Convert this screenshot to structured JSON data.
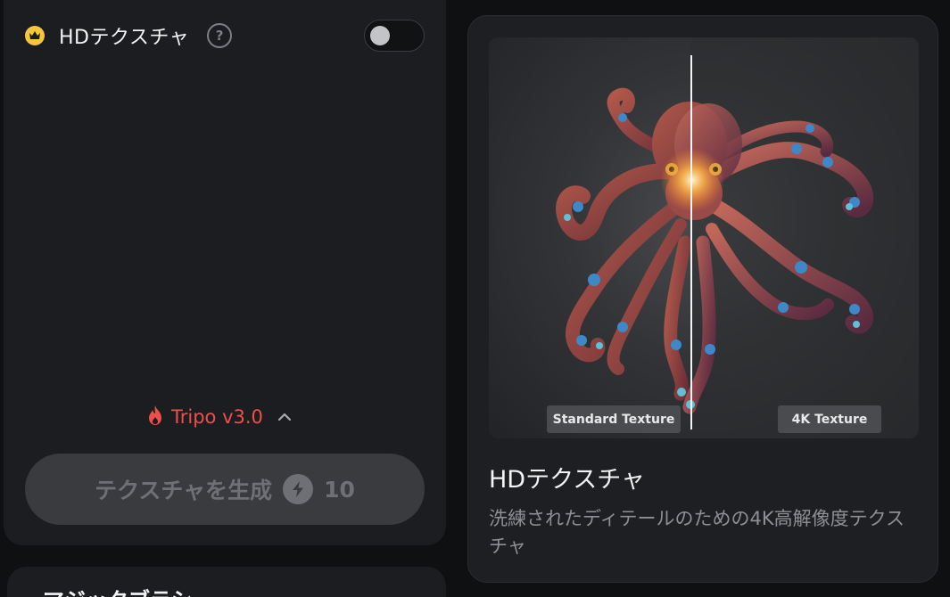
{
  "left_panel": {
    "hd_texture": {
      "label": "HDテクスチャ",
      "help_glyph": "?",
      "toggle_on": false,
      "badge_icon": "crown-icon",
      "badge_color": "#f6c73a"
    },
    "model_version": {
      "label": "Tripo v3.0",
      "icon": "flame-icon",
      "color": "#ef4f4a"
    },
    "generate_button": {
      "label": "テクスチャを生成",
      "credit_icon": "bolt-icon",
      "cost": "10",
      "disabled": true
    },
    "next_section": {
      "label": "マジックブラシ",
      "icon": "brush-icon"
    }
  },
  "feature_card": {
    "preview": {
      "left_label": "Standard Texture",
      "right_label": "4K Texture"
    },
    "title": "HDテクスチャ",
    "description": "洗練されたディテールのための4K高解像度テクスチャ"
  }
}
